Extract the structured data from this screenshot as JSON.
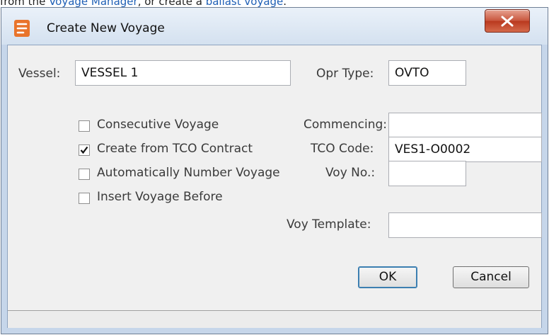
{
  "doc": {
    "prefix": "from the ",
    "link1": "Voyage Manager",
    "middle": ", or create a ",
    "link2": "ballast voyage",
    "suffix": "."
  },
  "dialog": {
    "title": "Create New Voyage",
    "icon": "app-logo-icon",
    "close_icon": "close-x-icon"
  },
  "form": {
    "vessel_label": "Vessel:",
    "vessel_value": "VESSEL 1",
    "opr_type_label": "Opr Type:",
    "opr_type_value": "OVTO",
    "consecutive_label": "Consecutive Voyage",
    "consecutive_checked": false,
    "create_tco_label": "Create from TCO Contract",
    "create_tco_checked": true,
    "auto_number_label": "Automatically Number Voyage",
    "auto_number_checked": false,
    "insert_before_label": "Insert Voyage Before",
    "insert_before_checked": false,
    "commencing_label": "Commencing:",
    "commencing_value": "",
    "tco_code_label": "TCO Code:",
    "tco_code_value": "VES1-O0002",
    "voy_no_label": "Voy No.:",
    "voy_no_value": "",
    "voy_template_label": "Voy Template:",
    "voy_template_value": ""
  },
  "buttons": {
    "ok": "OK",
    "cancel": "Cancel"
  },
  "colors": {
    "window_frame": "#c6d6ea",
    "close_button": "#c8553c",
    "link": "#1f5fb5",
    "client_bg": "#f0f0f0"
  }
}
